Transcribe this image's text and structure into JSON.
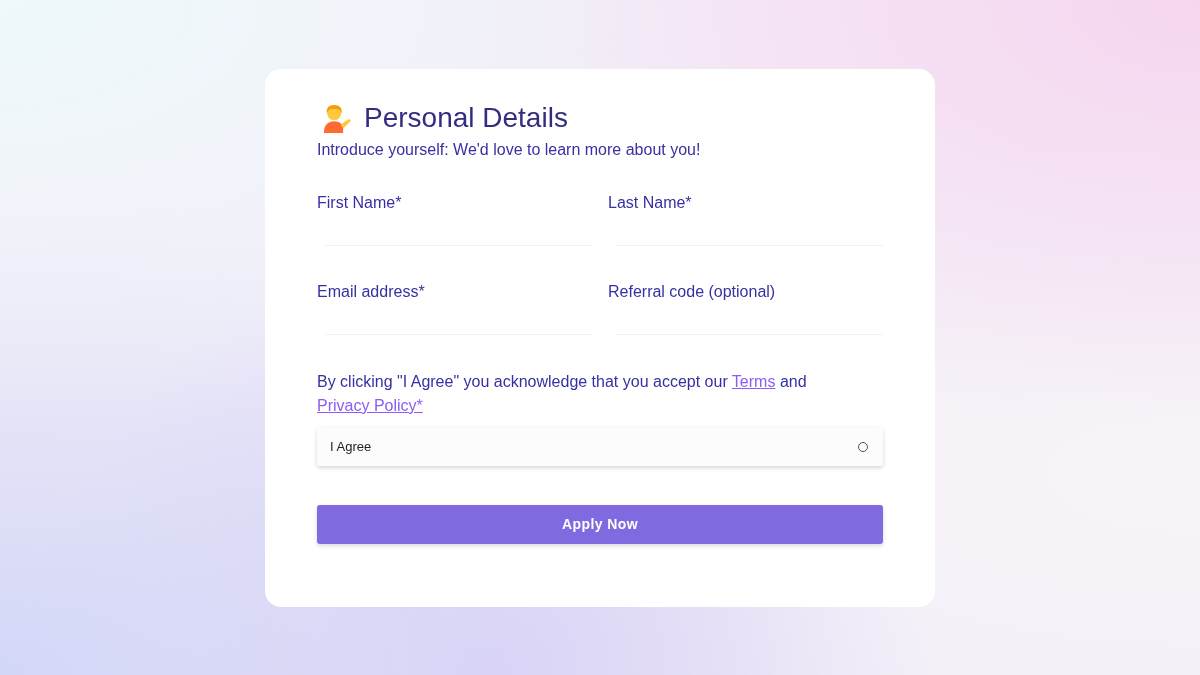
{
  "header": {
    "title": "Personal Details",
    "subtitle": "Introduce yourself: We'd love to learn more about you!"
  },
  "fields": [
    {
      "label": "First Name*"
    },
    {
      "label": "Last Name*"
    },
    {
      "label": "Email address*"
    },
    {
      "label": "Referral code (optional)"
    }
  ],
  "consent": {
    "parts": [
      {
        "kind": "text",
        "text": "By clicking \"I Agree\" you acknowledge that you accept our"
      },
      {
        "kind": "link",
        "text": "Terms"
      },
      {
        "kind": "text",
        "text": "and"
      },
      {
        "kind": "link",
        "text": "Privacy Policy*"
      }
    ]
  },
  "options": [
    {
      "label": "I Agree",
      "selected": false
    }
  ],
  "submit": {
    "label": "Apply Now"
  }
}
